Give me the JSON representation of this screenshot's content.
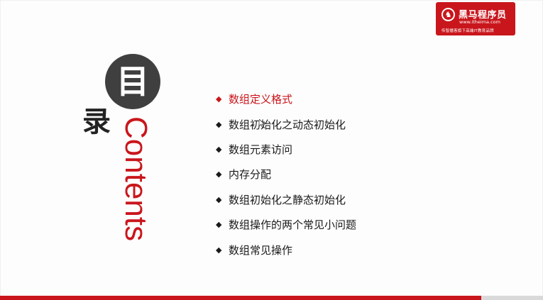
{
  "logo": {
    "name": "黑马程序员",
    "url": "www.itheima.com",
    "slogan": "传智播客旗下高端IT教育品牌",
    "emblem_icon": "horse-logo-icon"
  },
  "title": {
    "char1": "目",
    "char2": "录",
    "english": "Contents"
  },
  "toc": {
    "items": [
      {
        "label": "数组定义格式",
        "active": true
      },
      {
        "label": "数组初始化之动态初始化",
        "active": false
      },
      {
        "label": "数组元素访问",
        "active": false
      },
      {
        "label": "内存分配",
        "active": false
      },
      {
        "label": "数组初始化之静态初始化",
        "active": false
      },
      {
        "label": "数组操作的两个常见小问题",
        "active": false
      },
      {
        "label": "数组常见操作",
        "active": false
      }
    ],
    "bullet": "◆"
  },
  "colors": {
    "accent": "#c9161c",
    "circle": "#3f3f3f",
    "text": "#1a1a1a"
  }
}
